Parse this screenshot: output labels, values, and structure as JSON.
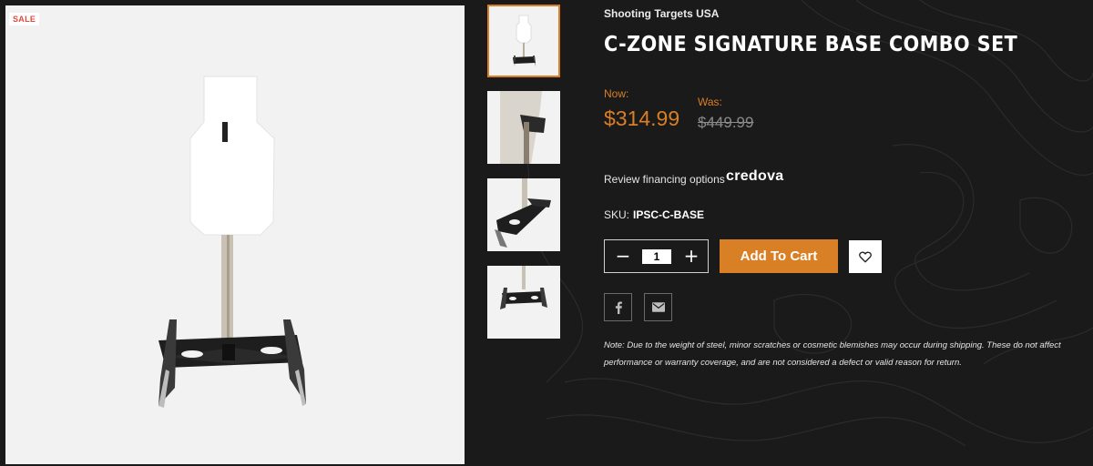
{
  "badge": {
    "sale": "SALE"
  },
  "product": {
    "brand": "Shooting Targets USA",
    "title": "C-Zone Signature Base Combo Set",
    "image_alt": "C-Zone steel target on signature base"
  },
  "thumbnails": [
    {
      "label": "Thumbnail 1 - full target"
    },
    {
      "label": "Thumbnail 2 - hanger close-up"
    },
    {
      "label": "Thumbnail 3 - base angle"
    },
    {
      "label": "Thumbnail 4 - base"
    }
  ],
  "pricing": {
    "now_label": "Now:",
    "now_price": "$314.99",
    "was_label": "Was:",
    "was_price": "$449.99"
  },
  "financing": {
    "text": "Review financing options",
    "provider": "credova"
  },
  "sku": {
    "label": "SKU:",
    "value": "IPSC-C-BASE"
  },
  "quantity": {
    "value": "1",
    "decrease": "−",
    "increase": "+"
  },
  "cart": {
    "add_label": "Add To Cart"
  },
  "icons": {
    "wishlist": "heart-icon",
    "share_facebook": "facebook-icon",
    "share_email": "email-icon"
  },
  "colors": {
    "background": "#1a1a1a",
    "accent": "#d97f25",
    "sale": "#e04a3f",
    "strike": "#8b8b8b"
  },
  "note": "Note: Due to the weight of steel, minor scratches or cosmetic blemishes may occur during shipping. These do not affect performance or warranty coverage, and are not considered a defect or valid reason for return."
}
